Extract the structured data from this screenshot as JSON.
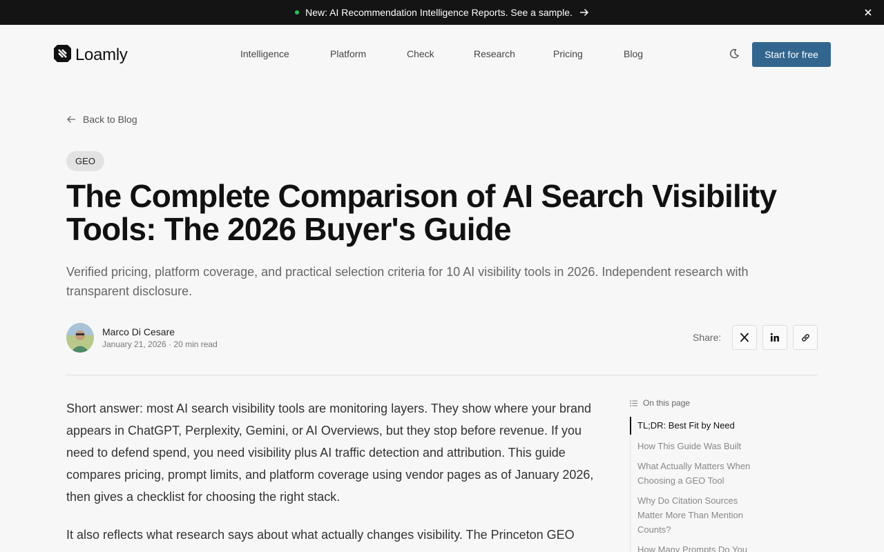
{
  "announcement": {
    "text": "New: AI Recommendation Intelligence Reports. See a sample."
  },
  "nav": {
    "logo_text": "Loamly",
    "links": [
      "Intelligence",
      "Platform",
      "Check",
      "Research",
      "Pricing",
      "Blog"
    ],
    "cta_label": "Start for free"
  },
  "article": {
    "back_label": "Back to Blog",
    "tag": "GEO",
    "title": "The Complete Comparison of AI Search Visibility Tools: The 2026 Buyer's Guide",
    "subtitle": "Verified pricing, platform coverage, and practical selection criteria for 10 AI visibility tools in 2026. Independent research with transparent disclosure.",
    "author_name": "Marco Di Cesare",
    "author_meta": "January 21, 2026 · 20 min read",
    "share_label": "Share:",
    "paragraphs": [
      "Short answer: most AI search visibility tools are monitoring layers. They show where your brand appears in ChatGPT, Perplexity, Gemini, or AI Overviews, but they stop before revenue. If you need to defend spend, you need visibility plus AI traffic detection and attribution. This guide compares pricing, prompt limits, and platform coverage using vendor pages as of January 2026, then gives a checklist for choosing the right stack.",
      "It also reflects what research says about what actually changes visibility. The Princeton GEO"
    ]
  },
  "toc": {
    "heading": "On this page",
    "items": [
      "TL;DR: Best Fit by Need",
      "How This Guide Was Built",
      "What Actually Matters When Choosing a GEO Tool",
      "Why Do Citation Sources Matter More Than Mention Counts?",
      "How Many Prompts Do You"
    ]
  },
  "colors": {
    "cta": "#32668f",
    "announcement_bg": "#141414",
    "announcement_dot": "#22c55e"
  }
}
